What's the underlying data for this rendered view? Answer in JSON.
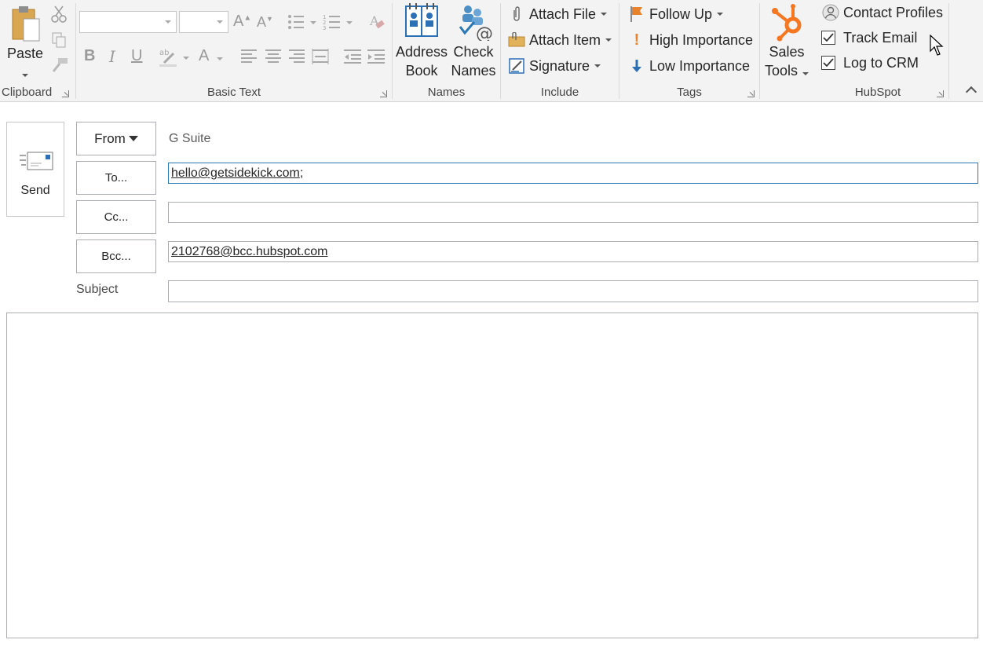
{
  "ribbon": {
    "clipboard": {
      "label": "Clipboard",
      "paste": "Paste"
    },
    "basic_text": {
      "label": "Basic Text",
      "bold": "B",
      "italic": "I",
      "underline": "U",
      "font_color": "A",
      "grow": "A",
      "shrink": "A"
    },
    "names": {
      "label": "Names",
      "address_book_1": "Address",
      "address_book_2": "Book",
      "check_names_1": "Check",
      "check_names_2": "Names"
    },
    "include": {
      "label": "Include",
      "attach_file": "Attach File",
      "attach_item": "Attach Item",
      "signature": "Signature"
    },
    "tags": {
      "label": "Tags",
      "follow_up": "Follow Up",
      "high_importance": "High Importance",
      "low_importance": "Low Importance"
    },
    "sales": {
      "line1": "Sales",
      "line2": "Tools"
    },
    "hubspot": {
      "label": "HubSpot",
      "contact_profiles": "Contact Profiles",
      "track_email": "Track Email",
      "track_email_checked": true,
      "log_to_crm": "Log to CRM",
      "log_to_crm_checked": true
    }
  },
  "compose": {
    "send": "Send",
    "from_label": "From",
    "from_value": "G Suite",
    "to_label": "To...",
    "to_value": "hello@getsidekick.com",
    "to_sep": ";",
    "cc_label": "Cc...",
    "cc_value": "",
    "bcc_label": "Bcc...",
    "bcc_value": "2102768@bcc.hubspot.com",
    "subject_label": "Subject",
    "subject_value": "",
    "body": ""
  },
  "colors": {
    "accent_blue": "#2b78b5",
    "hubspot_orange": "#f57722",
    "flag_orange": "#e8822c",
    "ribbon_bg": "#f3f3f3"
  }
}
